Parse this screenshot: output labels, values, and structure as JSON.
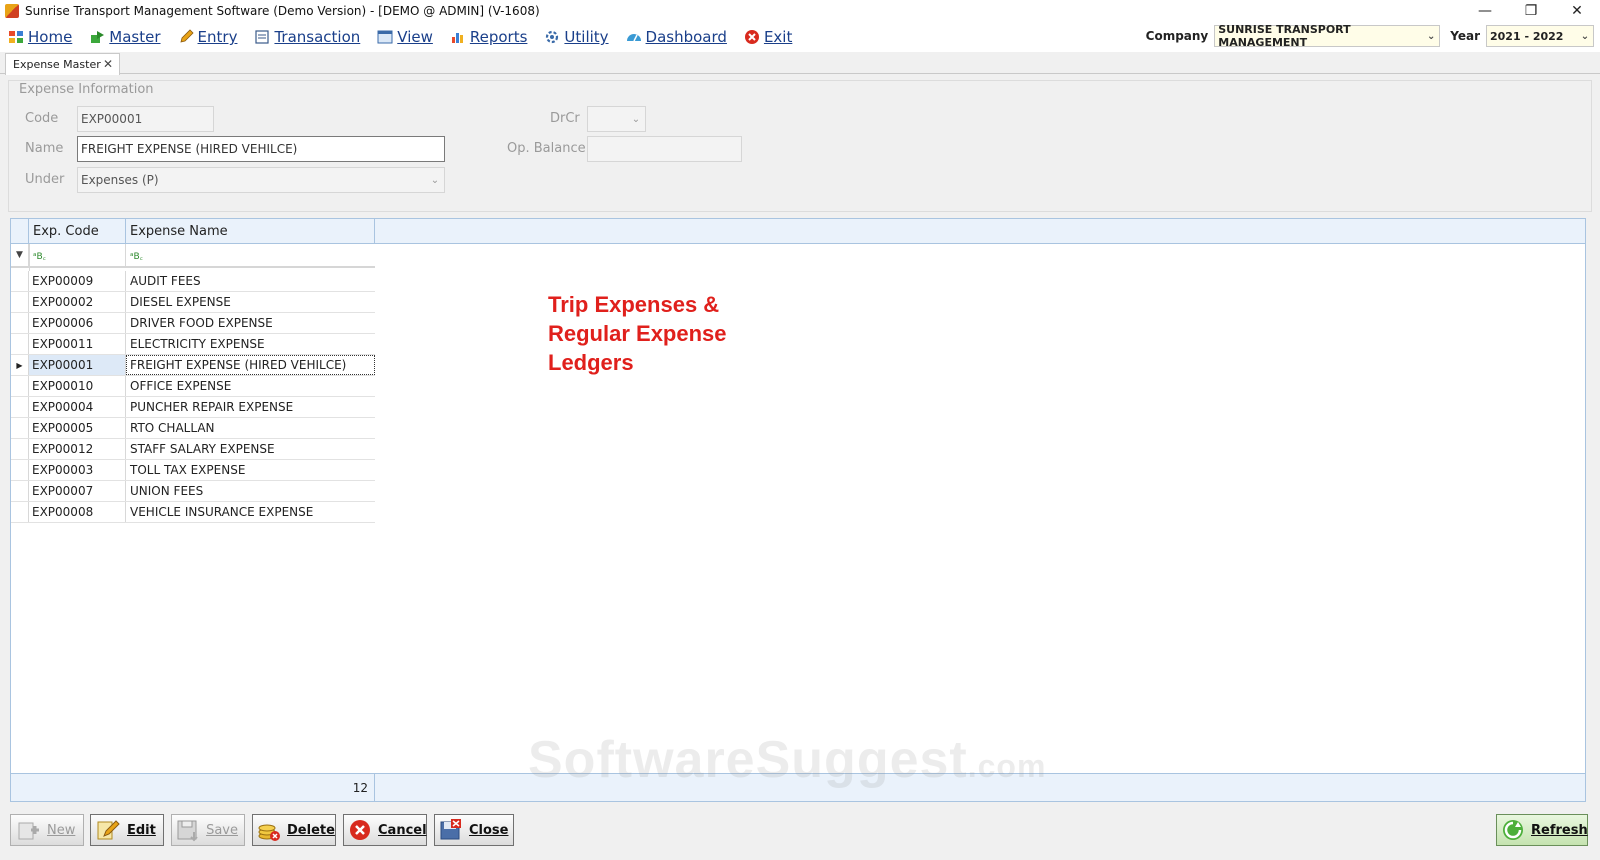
{
  "window": {
    "title": "Sunrise Transport Management Software (Demo Version) - [DEMO @ ADMIN] (V-1608)",
    "minimize": "—",
    "restore": "❐",
    "close": "✕"
  },
  "menu": {
    "items": [
      {
        "label": "Home",
        "icon": "home-icon"
      },
      {
        "label": "Master",
        "icon": "master-icon"
      },
      {
        "label": "Entry",
        "icon": "pencil-icon"
      },
      {
        "label": "Transaction",
        "icon": "transaction-icon"
      },
      {
        "label": "View",
        "icon": "view-icon"
      },
      {
        "label": "Reports",
        "icon": "bar-chart-icon"
      },
      {
        "label": "Utility",
        "icon": "utility-icon"
      },
      {
        "label": "Dashboard",
        "icon": "dashboard-icon"
      },
      {
        "label": "Exit",
        "icon": "exit-icon"
      }
    ],
    "company_label": "Company",
    "company_value": "SUNRISE TRANSPORT MANAGEMENT",
    "year_label": "Year",
    "year_value": "2021 - 2022"
  },
  "tab": {
    "label": "Expense Master",
    "close": "✕"
  },
  "form": {
    "legend": "Expense Information",
    "code_label": "Code",
    "code_value": "EXP00001",
    "name_label": "Name",
    "name_value": "FREIGHT EXPENSE (HIRED VEHILCE)",
    "under_label": "Under",
    "under_value": "Expenses (P)",
    "drcr_label": "DrCr",
    "drcr_value": "",
    "opbal_label": "Op. Balance",
    "opbal_value": ""
  },
  "grid": {
    "columns": [
      "Exp. Code",
      "Expense Name"
    ],
    "filter_icon": "ᵃB꜀",
    "selected_code": "EXP00001",
    "rows": [
      {
        "code": "EXP00009",
        "name": "AUDIT FEES"
      },
      {
        "code": "EXP00002",
        "name": "DIESEL EXPENSE"
      },
      {
        "code": "EXP00006",
        "name": "DRIVER FOOD EXPENSE"
      },
      {
        "code": "EXP00011",
        "name": "ELECTRICITY EXPENSE"
      },
      {
        "code": "EXP00001",
        "name": "FREIGHT EXPENSE (HIRED VEHILCE)"
      },
      {
        "code": "EXP00010",
        "name": "OFFICE EXPENSE"
      },
      {
        "code": "EXP00004",
        "name": "PUNCHER REPAIR EXPENSE"
      },
      {
        "code": "EXP00005",
        "name": "RTO CHALLAN"
      },
      {
        "code": "EXP00012",
        "name": "STAFF SALARY EXPENSE"
      },
      {
        "code": "EXP00003",
        "name": "TOLL TAX EXPENSE"
      },
      {
        "code": "EXP00007",
        "name": "UNION FEES"
      },
      {
        "code": "EXP00008",
        "name": "VEHICLE INSURANCE EXPENSE"
      }
    ],
    "count": "12"
  },
  "annotation": {
    "lines": [
      "Trip Expenses &",
      "Regular Expense",
      "Ledgers"
    ]
  },
  "watermark": {
    "main": "SoftwareSuggest",
    "suffix": ".com"
  },
  "buttons": {
    "new": "New",
    "edit": "Edit",
    "save": "Save",
    "delete": "Delete",
    "cancel": "Cancel",
    "close": "Close",
    "refresh": "Refresh"
  },
  "colors": {
    "accent_text": "#1a3f8a",
    "annotation": "#e0201c",
    "grid_border": "#a9c4e0",
    "grid_header": "#eaf2fb"
  }
}
